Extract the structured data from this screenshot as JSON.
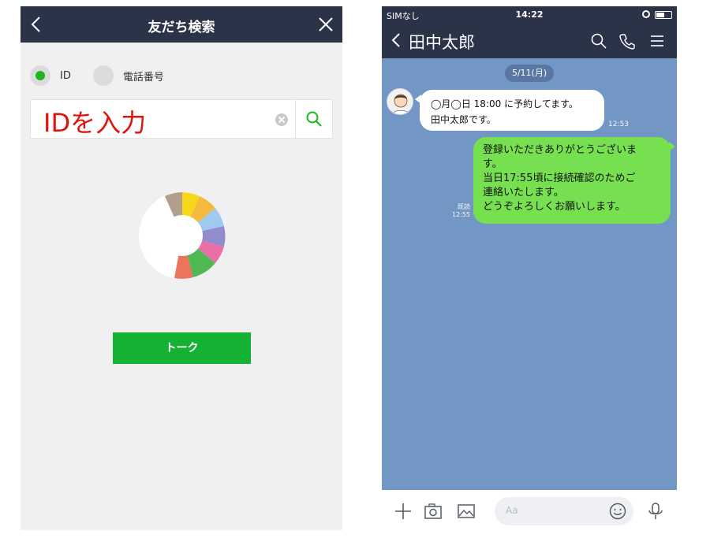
{
  "left": {
    "title": "友だち検索",
    "options": [
      {
        "label": "ID",
        "selected": true
      },
      {
        "label": "電話番号",
        "selected": false
      }
    ],
    "search_value": "IDを入力",
    "talk_button": "トーク",
    "icons": {
      "back": "back-chevron-icon",
      "close": "close-icon",
      "search": "search-icon",
      "clear": "clear-icon"
    }
  },
  "right": {
    "status": {
      "carrier": "SIMなし",
      "time": "14:22"
    },
    "contact_name": "田中太郎",
    "date": "5/11(月)",
    "incoming": {
      "line1": "◯月◯日 18:00 に予約してます。",
      "line2": "田中太郎です。",
      "time": "12:53"
    },
    "outgoing": {
      "lines": [
        "登録いただきありがとうございま",
        "す。",
        "当日17:55頃に接続確認のためご",
        "連絡いたします。",
        "どうぞよろしくお願いします。"
      ],
      "read": "既読",
      "time": "12:55"
    },
    "composer_placeholder": "Aa"
  },
  "colors": {
    "header": "#2a3347",
    "line_green": "#15b132",
    "bubble_green": "#77e050",
    "chat_bg": "#7397c4",
    "input_red": "#e0120c"
  }
}
